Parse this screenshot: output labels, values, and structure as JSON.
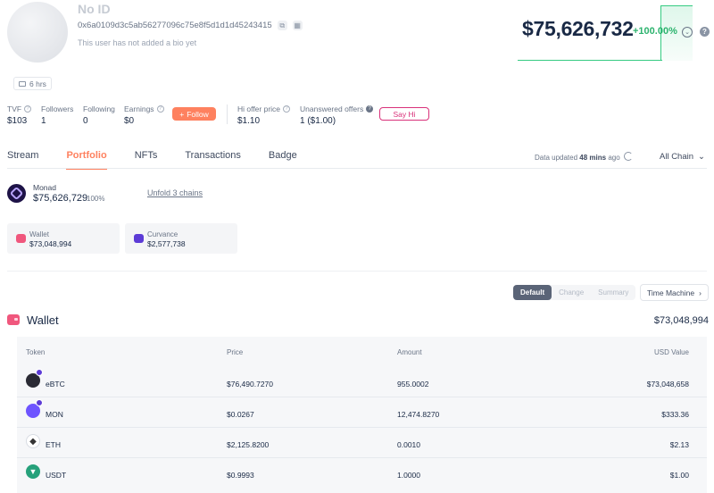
{
  "profile": {
    "name": "No ID",
    "address": "0x6a0109d3c5ab56277096c75e8f5d1d1d45243415",
    "bio": "This user has not added a bio yet",
    "age": "6 hrs",
    "net_worth": "$75,626,732",
    "change": "+100.00%"
  },
  "stats": {
    "tvf_label": "TVF",
    "tvf_value": "$103",
    "followers_label": "Followers",
    "followers_value": "1",
    "following_label": "Following",
    "following_value": "0",
    "earnings_label": "Earnings",
    "earnings_value": "$0",
    "follow_label": "Follow",
    "hi_offer_label": "Hi offer price",
    "hi_offer_value": "$1.10",
    "unanswered_label": "Unanswered offers",
    "unanswered_value": "1 ($1.00)",
    "say_hi_label": "Say Hi"
  },
  "tabs": [
    "Stream",
    "Portfolio",
    "NFTs",
    "Transactions",
    "Badge"
  ],
  "active_tab": "Portfolio",
  "updated": {
    "prefix": "Data updated",
    "mins": "48 mins",
    "suffix": "ago",
    "chain_select": "All Chain"
  },
  "chain": {
    "name": "Monad",
    "value": "$75,626,729",
    "percent": "100%",
    "unfold_label": "Unfold 3 chains"
  },
  "protocols": [
    {
      "name": "Wallet",
      "value": "$73,048,994",
      "color": "#f0577d"
    },
    {
      "name": "Curvance",
      "value": "$2,577,738",
      "color": "#5c3bd6"
    }
  ],
  "view_buttons": [
    "Default",
    "Change",
    "Summary"
  ],
  "active_view": "Default",
  "time_machine_label": "Time Machine",
  "wallet": {
    "title": "Wallet",
    "total": "$73,048,994",
    "columns": [
      "Token",
      "Price",
      "Amount",
      "USD Value"
    ],
    "rows": [
      {
        "token": "eBTC",
        "price": "$76,490.7270",
        "amount": "955.0002",
        "usd": "$73,048,658",
        "icon": "ebtc-icon",
        "color": "#2a2a34"
      },
      {
        "token": "MON",
        "price": "$0.0267",
        "amount": "12,474.8270",
        "usd": "$333.36",
        "icon": "mon-icon",
        "color": "#6e54ff"
      },
      {
        "token": "ETH",
        "price": "$2,125.8200",
        "amount": "0.0010",
        "usd": "$2.13",
        "icon": "eth-icon",
        "color": "#ffffff"
      },
      {
        "token": "USDT",
        "price": "$0.9993",
        "amount": "1.0000",
        "usd": "$1.00",
        "icon": "usdt-icon",
        "color": "#26a17b"
      }
    ]
  },
  "colors": {
    "accent": "#fe815f",
    "positive": "#2cb36e",
    "say_hi": "#d9317a"
  }
}
